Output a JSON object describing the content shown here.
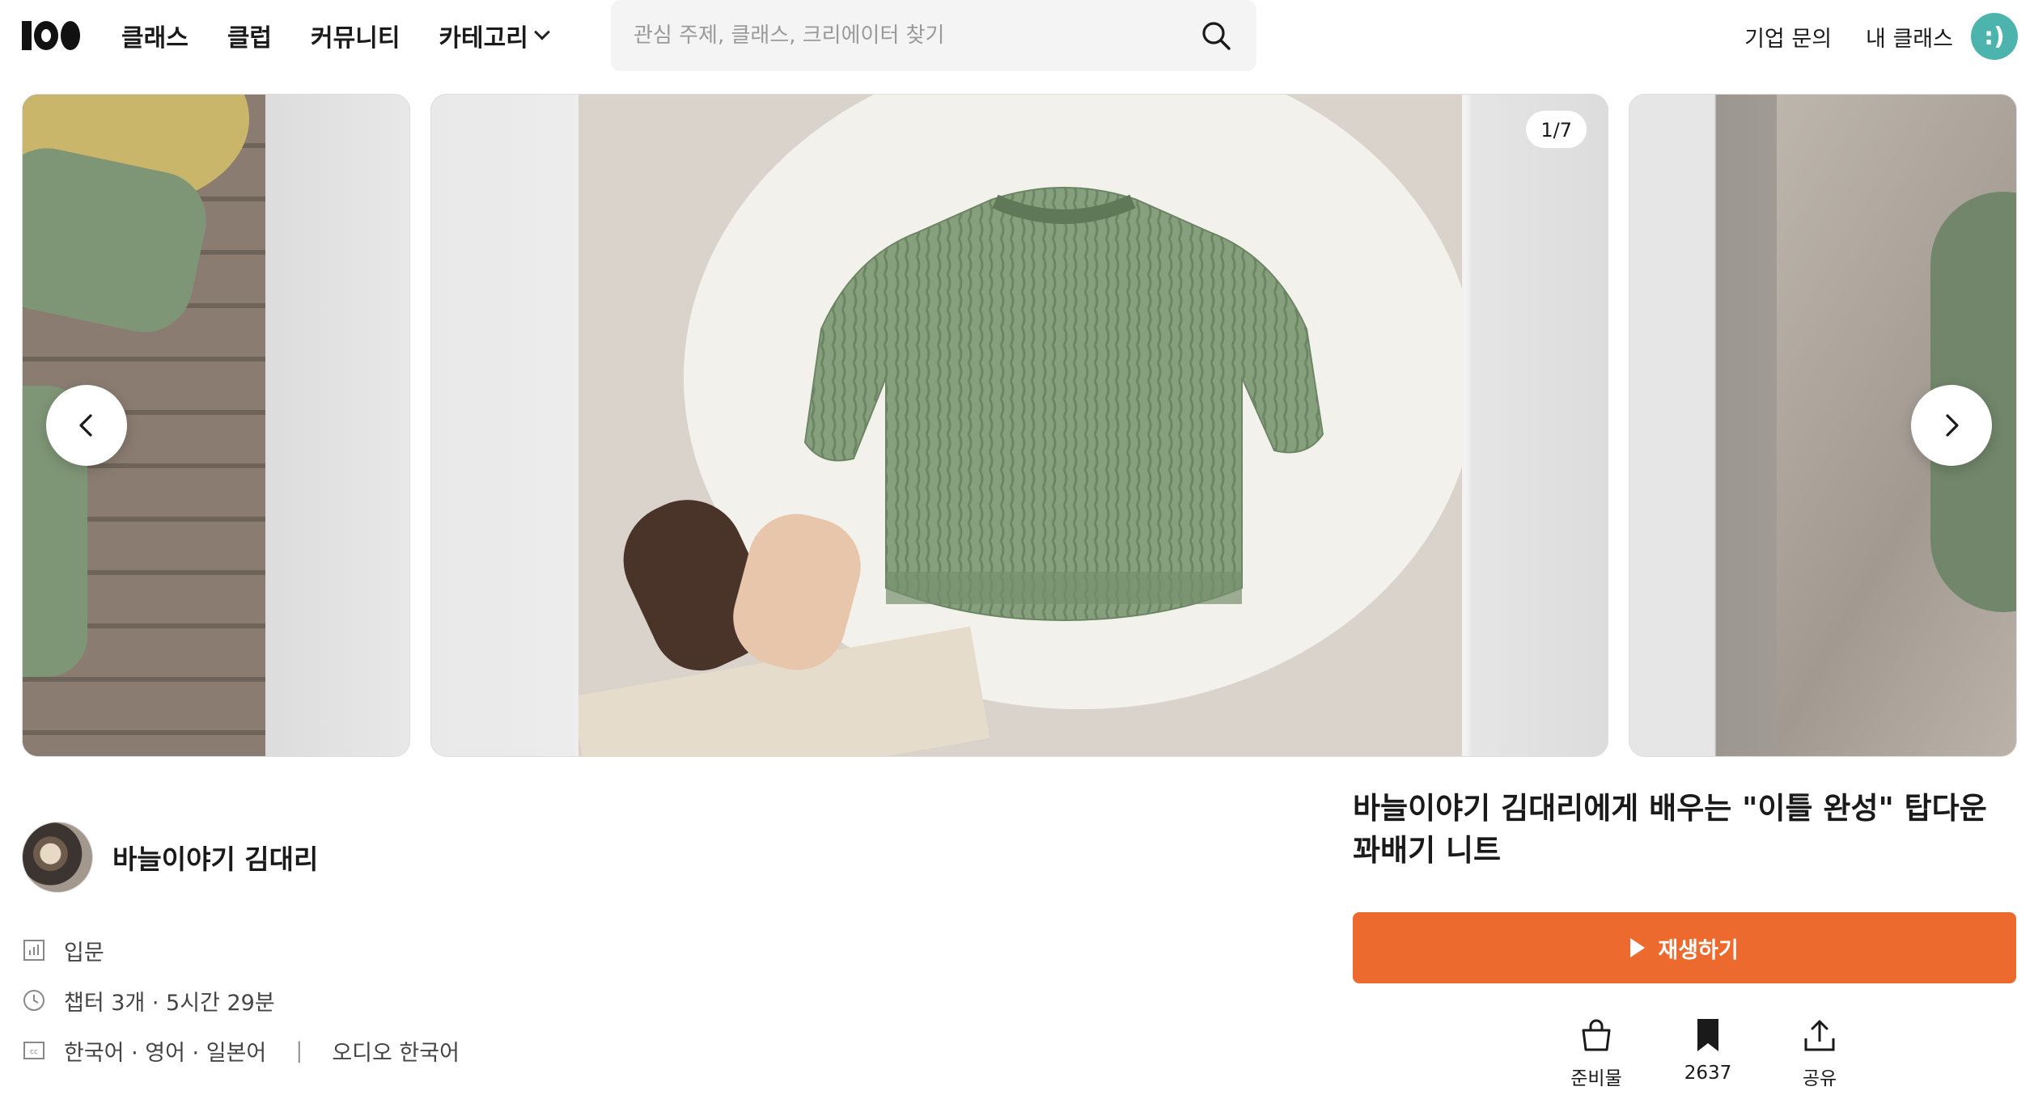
{
  "header": {
    "logo_label": "101",
    "nav": [
      {
        "label": "클래스"
      },
      {
        "label": "클럽"
      },
      {
        "label": "커뮤니티"
      },
      {
        "label": "카테고리"
      }
    ],
    "search_placeholder": "관심 주제, 클래스, 크리에이터 찾기",
    "links": [
      {
        "label": "기업 문의"
      },
      {
        "label": "내 클래스"
      }
    ],
    "profile_text": ":)"
  },
  "carousel": {
    "counter": "1/7",
    "current_slide": 1,
    "total_slides": 7
  },
  "creator": {
    "name": "바늘이야기 김대리"
  },
  "meta": {
    "level": "입문",
    "duration": "챕터 3개 · 5시간 29분",
    "subtitles": "한국어 · 영어 · 일본어",
    "separator": "|",
    "audio": "오디오 한국어"
  },
  "course": {
    "title": "바늘이야기 김대리에게 배우는 \"이틀 완성\" 탑다운 꽈배기 니트",
    "play_label": "재생하기",
    "accent_color": "#ed6a2e"
  },
  "actions": [
    {
      "label": "준비물",
      "icon": "shopping-bag-icon"
    },
    {
      "label": "2637",
      "icon": "bookmark-icon"
    },
    {
      "label": "공유",
      "icon": "share-icon"
    }
  ]
}
